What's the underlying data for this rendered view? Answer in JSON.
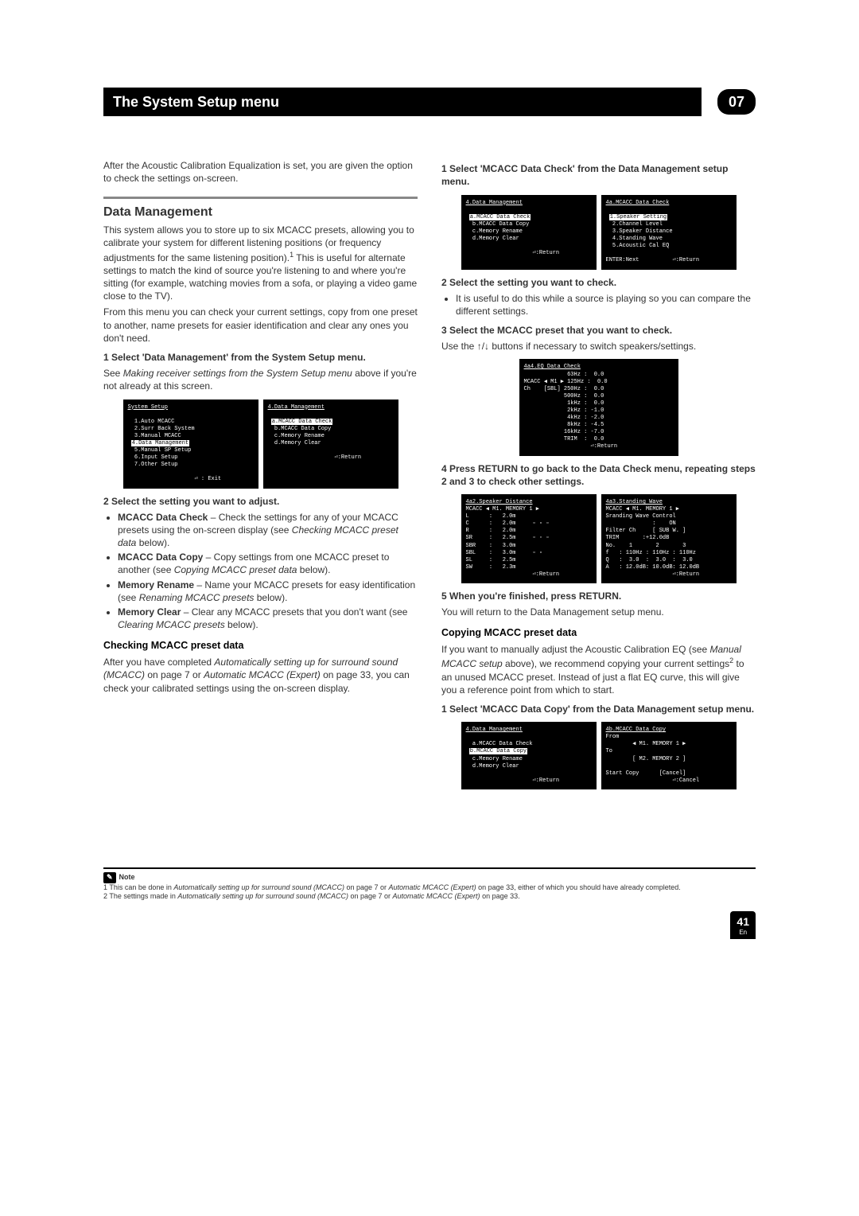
{
  "header": {
    "title": "The System Setup menu",
    "chapter": "07"
  },
  "left": {
    "intro": "After the Acoustic Calibration Equalization is set, you are given the option to check the settings on-screen.",
    "dm_head": "Data Management",
    "dm_p1a": "This system allows you to store up to six MCACC presets, allowing you to calibrate your system for different listening positions (or frequency adjustments for the same listening position).",
    "dm_p1b": " This is useful for alternate settings to match the kind of source you're listening to and where you're sitting (for example, watching movies from a sofa, or playing a video game close to the TV).",
    "dm_p2": "From this menu you can check your current settings, copy from one preset to another, name presets for easier identification and clear any ones you don't need.",
    "step1": "1    Select 'Data Management' from the System Setup menu.",
    "step1_sub_a": "See ",
    "step1_sub_b": "Making receiver settings from the System Setup menu",
    "step1_sub_c": " above if you're not already at this screen.",
    "osd_sys_title": "System Setup",
    "osd_sys_lines": [
      "1.Auto MCACC",
      "2.Surr Back System",
      "3.Manual MCACC",
      "4.Data Management",
      "5.Manual SP Setup",
      "6.Input Setup",
      "7.Other Setup"
    ],
    "osd_sys_hl": 3,
    "osd_sys_foot": "⏎ : Exit",
    "osd_dm_title": "4.Data Management",
    "osd_dm_lines": [
      "a.MCACC Data Check",
      "b.MCACC Data Copy",
      "c.Memory Rename",
      "d.Memory Clear"
    ],
    "osd_dm_hl": 0,
    "osd_dm_foot": "⏎:Return",
    "step2": "2    Select the setting you want to adjust.",
    "b1_a": "MCACC Data Check",
    "b1_b": " – Check the settings for any of your MCACC presets using the on-screen display (see ",
    "b1_c": "Checking MCACC preset data",
    "b1_d": " below).",
    "b2_a": "MCACC Data Copy",
    "b2_b": " – Copy settings from one MCACC preset to another (see ",
    "b2_c": "Copying MCACC preset data",
    "b2_d": " below).",
    "b3_a": "Memory Rename",
    "b3_b": " – Name your MCACC presets for easy identification (see ",
    "b3_c": "Renaming MCACC presets",
    "b3_d": " below).",
    "b4_a": "Memory Clear",
    "b4_b": " – Clear any MCACC presets that you don't want (see ",
    "b4_c": "Clearing MCACC presets",
    "b4_d": " below).",
    "check_head": "Checking MCACC preset data",
    "check_p_a": "After you have completed ",
    "check_p_b": "Automatically setting up for surround sound (MCACC)",
    "check_p_c": " on page 7 or ",
    "check_p_d": "Automatic MCACC (Expert)",
    "check_p_e": " on page 33, you can check your calibrated settings using the on-screen display."
  },
  "right": {
    "step1": "1    Select 'MCACC Data Check' from the Data Management setup menu.",
    "osd_dm2_title": "4.Data Management",
    "osd_dm2_lines": [
      "a.MCACC Data Check",
      "b.MCACC Data Copy",
      "c.Memory Rename",
      "d.Memory Clear"
    ],
    "osd_dm2_hl": 0,
    "osd_dm2_foot": "⏎:Return",
    "osd_chk_title": "4a.MCACC Data Check",
    "osd_chk_lines": [
      "1.Speaker Setting",
      "2.Channel Level",
      "3.Speaker Distance",
      "4.Standing Wave",
      "5.Acoustic Cal EQ"
    ],
    "osd_chk_hl": 0,
    "osd_chk_foot": "ENTER:Next          ⏎:Return",
    "step2": "2    Select the setting you want to check.",
    "step2_sub": "It is useful to do this while a source is playing so you can compare the different settings.",
    "step3": "3    Select the MCACC preset that you want to check.",
    "step3_sub_a": "Use the ",
    "step3_sub_b": " buttons if necessary to switch speakers/settings.",
    "arrows": "↑/↓",
    "osd_eq_title": "4a4.EQ Data Check",
    "osd_eq_body": "             63Hz :  0.0\nMCACC ◀ M1 ▶ 125Hz :  0.0\nCh    [SBL] 250Hz :  0.0\n            500Hz :  0.0\n             1kHz :  0.0\n             2kHz : -1.0\n             4kHz : -2.0\n             8kHz : -4.5\n            16kHz : -7.0\n            TRIM  :  0.0",
    "osd_eq_foot": "⏎:Return",
    "step4": "4    Press RETURN to go back to the Data Check menu, repeating steps 2 and 3 to check other settings.",
    "osd_sp_title": "4a2.Speaker Distance",
    "osd_sp_body": "MCACC ◀ M1. MEMORY 1 ▶\nL      :   2.0m\nC      :   2.0m     ▫ ▫ ▫\nR      :   2.0m\nSR     :   2.5m     ▫ ◦ ▫\nSBR    :   3.0m\nSBL    :   3.0m     ▫ ▫\nSL     :   2.5m\nSW     :   2.3m",
    "osd_sp_foot": "⏎:Return",
    "osd_sw_title": "4a3.Standing Wave",
    "osd_sw_body": "MCACC ◀ M1. MEMORY 1 ▶\nSranding Wave Control\n              :    ON\nFilter Ch     [ SUB W. ]\nTRIM       :+12.0dB\nNo.    1       2       3\nf   : 110Hz : 110Hz : 110Hz\nQ   :  3.0  :  3.0  :  3.0\nA   : 12.0dB: 10.0dB: 12.0dB",
    "osd_sw_foot": "⏎:Return",
    "step5": "5    When you're finished, press RETURN.",
    "step5_sub": "You will return to the Data Management setup menu.",
    "copy_head": "Copying MCACC preset data",
    "copy_p1_a": "If you want to manually adjust the Acoustic Calibration EQ (see ",
    "copy_p1_b": "Manual MCACC setup",
    "copy_p1_c": " above), we recommend copying your current settings",
    "copy_p1_d": " to an unused MCACC preset. Instead of just a flat EQ curve, this will give you a reference point from which to start.",
    "cstep1": "1    Select 'MCACC Data Copy' from the Data Management setup menu.",
    "osd_dm3_title": "4.Data Management",
    "osd_dm3_lines": [
      "a.MCACC Data Check",
      "b.MCACC Data Copy",
      "c.Memory Rename",
      "d.Memory Clear"
    ],
    "osd_dm3_hl": 1,
    "osd_dm3_foot": "⏎:Return",
    "osd_copy_title": "4b.MCACC Data Copy",
    "osd_copy_body": "From\n        ◀ M1. MEMORY 1 ▶\nTo\n        [ M2. MEMORY 2 ]\n\nStart Copy      [Cancel]",
    "osd_copy_foot": "⏎:Cancel"
  },
  "notes": {
    "label": "Note",
    "n1_a": "1  This can be done in ",
    "n1_b": "Automatically setting up for surround sound (MCACC)",
    "n1_c": " on page 7 or ",
    "n1_d": "Automatic MCACC (Expert)",
    "n1_e": " on page 33, either of which you should have already completed.",
    "n2_a": "2  The settings made in ",
    "n2_b": "Automatically setting up for surround sound (MCACC)",
    "n2_c": " on page 7 or ",
    "n2_d": "Automatic MCACC (Expert)",
    "n2_e": " on page 33."
  },
  "page": {
    "num": "41",
    "lang": "En"
  }
}
